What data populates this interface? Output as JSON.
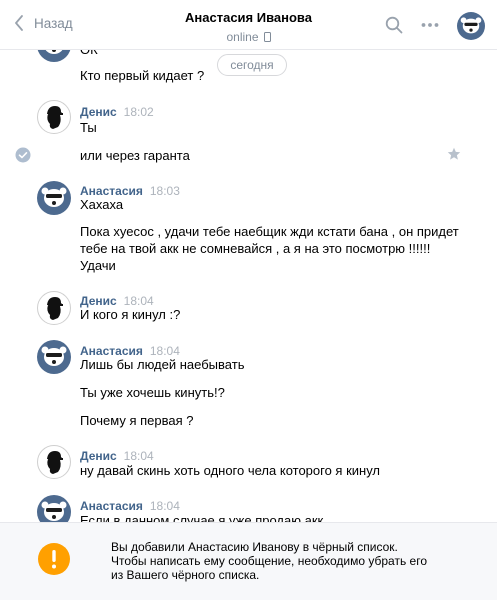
{
  "header": {
    "back_label": "Назад",
    "title": "Анастасия Иванова",
    "status": "online"
  },
  "date_divider": "сегодня",
  "messages": [
    {
      "author": "",
      "time": "",
      "lines": [
        "ОК",
        "Кто первый кидает ?"
      ]
    },
    {
      "author": "Денис",
      "time": "18:02",
      "lines": [
        "Ты",
        "или через гаранта"
      ]
    },
    {
      "author": "Анастасия",
      "time": "18:03",
      "lines": [
        "Хахаха",
        "Пока хуесос , удачи тебе наебщик жди кстати бана , он придет",
        "тебе на твой акк не сомневайся , а я на это посмотрю !!!!!!",
        "Удачи"
      ]
    },
    {
      "author": "Денис",
      "time": "18:04",
      "lines": [
        "И кого я кинул :?"
      ]
    },
    {
      "author": "Анастасия",
      "time": "18:04",
      "lines": [
        "Лишь бы людей наебывать",
        "Ты уже хочешь кинуть!?",
        "Почему я первая ?"
      ]
    },
    {
      "author": "Денис",
      "time": "18:04",
      "lines": [
        "ну давай скинь хоть одного чела которого я кинул"
      ]
    },
    {
      "author": "Анастасия",
      "time": "18:04",
      "lines": [
        "Если в данном случае я уже продаю акк"
      ]
    }
  ],
  "notice": {
    "text": "Вы добавили Анастасию Иванову в чёрный список. Чтобы написать ему сообщение, необходимо убрать его из Вашего чёрного списка."
  },
  "icons": {
    "back": "chevron-left-icon",
    "search": "search-icon",
    "more": "more-dots-icon",
    "phone": "phone-icon",
    "check": "check-circle-icon",
    "star": "star-icon",
    "warning": "warning-icon"
  },
  "colors": {
    "accent": "#42648b",
    "muted": "#818c99",
    "avatar_blue": "#4d6a8f",
    "warning": "#ffa000"
  }
}
